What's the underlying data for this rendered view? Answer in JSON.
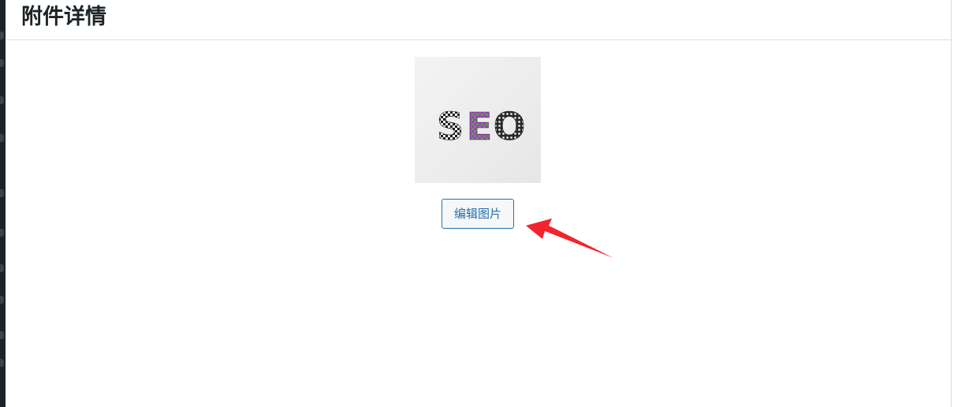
{
  "modal": {
    "title": "附件详情"
  },
  "attachment": {
    "image_text": "SEO",
    "edit_button_label": "编辑图片"
  },
  "colors": {
    "accent": "#2271b1",
    "annotation_arrow": "#f5222d",
    "sidebar": "#1d2327"
  },
  "icons": {
    "annotation": "red-arrow-icon"
  }
}
